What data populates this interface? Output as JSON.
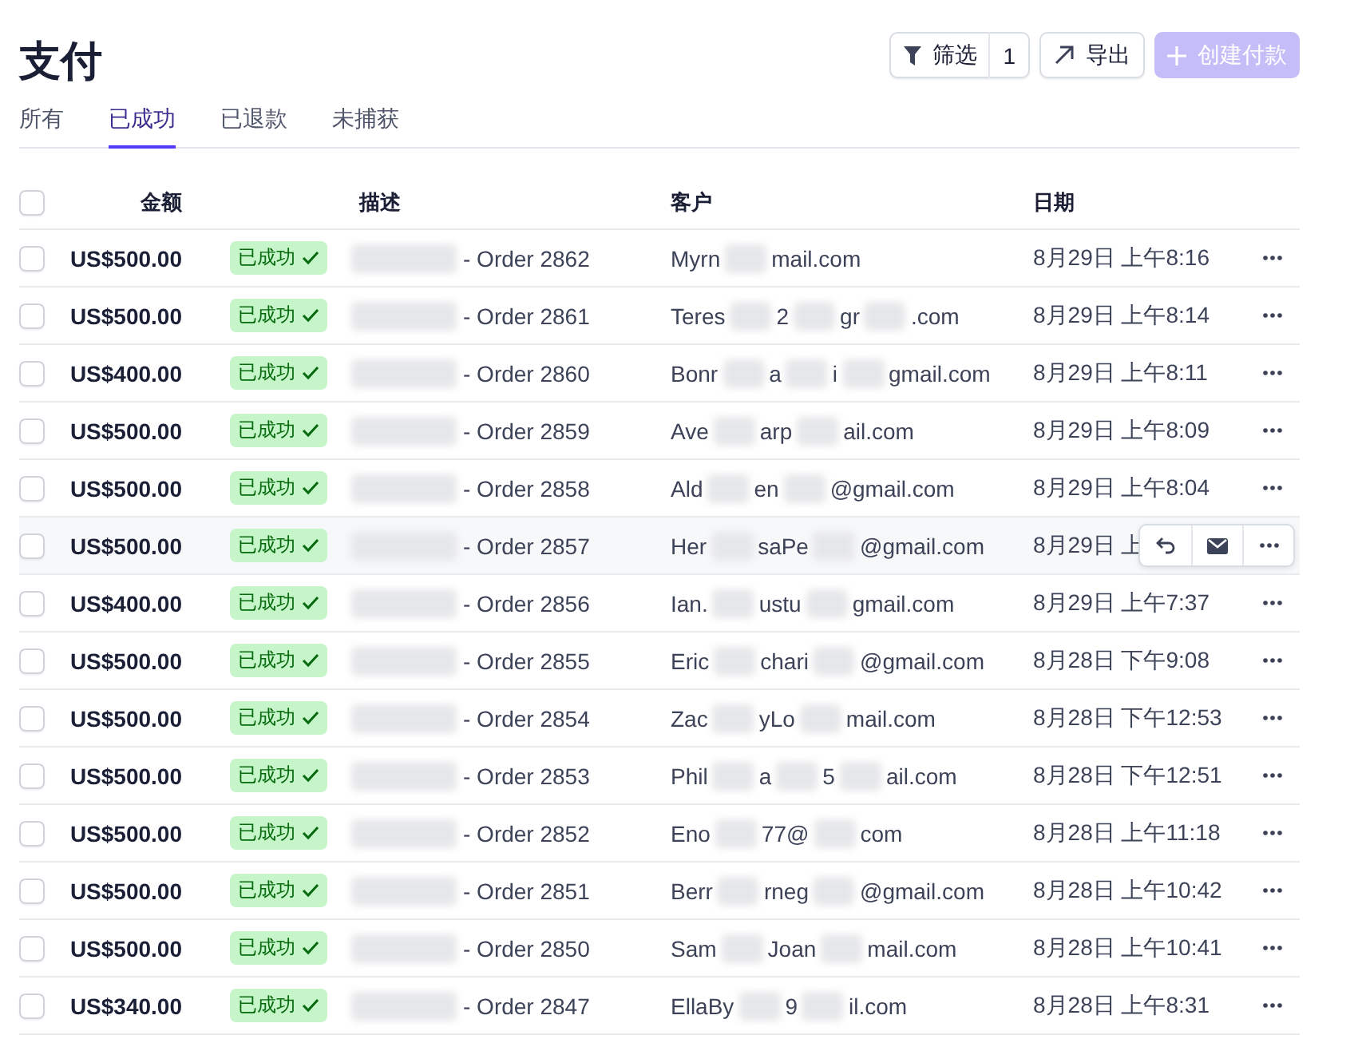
{
  "page": {
    "title": "支付"
  },
  "toolbar": {
    "filter": {
      "label": "筛选",
      "count": "1"
    },
    "export": {
      "label": "导出"
    },
    "create": {
      "label": "创建付款",
      "disabled": true
    }
  },
  "tabs": [
    {
      "label": "所有",
      "selected": false
    },
    {
      "label": "已成功",
      "selected": true
    },
    {
      "label": "已退款",
      "selected": false
    },
    {
      "label": "未捕获",
      "selected": false
    }
  ],
  "table": {
    "select_all_checked": false,
    "columns": [
      "金额",
      "描述",
      "客户",
      "日期"
    ],
    "rows": [
      {
        "checked": false,
        "hovered": false,
        "amount": "US$500.00",
        "status": "已成功",
        "description": "- Order 2862",
        "customer_parts": [
          "Myrn",
          "mail.com"
        ],
        "date": "8月29日 上午8:16"
      },
      {
        "checked": false,
        "hovered": false,
        "amount": "US$500.00",
        "status": "已成功",
        "description": "- Order 2861",
        "customer_parts": [
          "Teres",
          "2",
          "gr",
          ".com"
        ],
        "date": "8月29日 上午8:14"
      },
      {
        "checked": false,
        "hovered": false,
        "amount": "US$400.00",
        "status": "已成功",
        "description": "- Order 2860",
        "customer_parts": [
          "Bonr",
          "a",
          "i",
          "gmail.com"
        ],
        "date": "8月29日 上午8:11"
      },
      {
        "checked": false,
        "hovered": false,
        "amount": "US$500.00",
        "status": "已成功",
        "description": "- Order 2859",
        "customer_parts": [
          "Ave",
          "arp",
          "ail.com"
        ],
        "date": "8月29日 上午8:09"
      },
      {
        "checked": false,
        "hovered": false,
        "amount": "US$500.00",
        "status": "已成功",
        "description": "- Order 2858",
        "customer_parts": [
          "Ald",
          "en",
          "@gmail.com"
        ],
        "date": "8月29日 上午8:04"
      },
      {
        "checked": false,
        "hovered": true,
        "amount": "US$500.00",
        "status": "已成功",
        "description": "- Order 2857",
        "customer_parts": [
          "Her",
          "saPe",
          "@gmail.com"
        ],
        "date": "8月29日 上"
      },
      {
        "checked": false,
        "hovered": false,
        "amount": "US$400.00",
        "status": "已成功",
        "description": "- Order 2856",
        "customer_parts": [
          "Ian.",
          "ustu",
          "gmail.com"
        ],
        "date": "8月29日 上午7:37"
      },
      {
        "checked": false,
        "hovered": false,
        "amount": "US$500.00",
        "status": "已成功",
        "description": "- Order 2855",
        "customer_parts": [
          "Eric",
          "chari",
          "@gmail.com"
        ],
        "date": "8月28日 下午9:08"
      },
      {
        "checked": false,
        "hovered": false,
        "amount": "US$500.00",
        "status": "已成功",
        "description": "- Order 2854",
        "customer_parts": [
          "Zac",
          "yLo",
          "mail.com"
        ],
        "date": "8月28日 下午12:53"
      },
      {
        "checked": false,
        "hovered": false,
        "amount": "US$500.00",
        "status": "已成功",
        "description": "- Order 2853",
        "customer_parts": [
          "Phil",
          "a",
          "5",
          "ail.com"
        ],
        "date": "8月28日 下午12:51"
      },
      {
        "checked": false,
        "hovered": false,
        "amount": "US$500.00",
        "status": "已成功",
        "description": "- Order 2852",
        "customer_parts": [
          "Eno",
          "77@",
          "com"
        ],
        "date": "8月28日 上午11:18"
      },
      {
        "checked": false,
        "hovered": false,
        "amount": "US$500.00",
        "status": "已成功",
        "description": "- Order 2851",
        "customer_parts": [
          "Berr",
          "rneg",
          "@gmail.com"
        ],
        "date": "8月28日 上午10:42"
      },
      {
        "checked": false,
        "hovered": false,
        "amount": "US$500.00",
        "status": "已成功",
        "description": "- Order 2850",
        "customer_parts": [
          "Sam",
          "Joan",
          "mail.com"
        ],
        "date": "8月28日 上午10:41"
      },
      {
        "checked": false,
        "hovered": false,
        "amount": "US$340.00",
        "status": "已成功",
        "description": "- Order 2847",
        "customer_parts": [
          "EllaBy",
          "9",
          "il.com"
        ],
        "date": "8月28日 上午8:31"
      }
    ]
  }
}
